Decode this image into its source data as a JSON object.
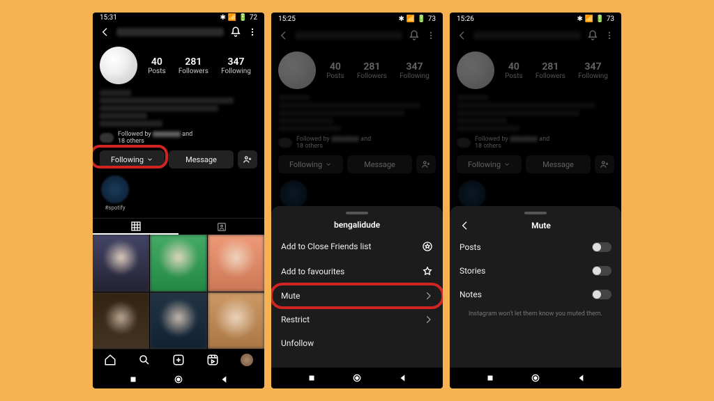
{
  "phones": [
    {
      "time": "15:31",
      "battery": "72"
    },
    {
      "time": "15:25",
      "battery": "73"
    },
    {
      "time": "15:26",
      "battery": "73"
    }
  ],
  "stats": {
    "posts": {
      "n": "40",
      "l": "Posts"
    },
    "followers": {
      "n": "281",
      "l": "Followers"
    },
    "following": {
      "n": "347",
      "l": "Following"
    }
  },
  "followed_by": "Followed by",
  "followed_others": "18 others",
  "buttons": {
    "following": "Following",
    "message": "Message"
  },
  "story_label": "#spotify",
  "sheet1": {
    "title": "bengalidude",
    "close_friends": "Add to Close Friends list",
    "favourites": "Add to favourites",
    "mute": "Mute",
    "restrict": "Restrict",
    "unfollow": "Unfollow"
  },
  "sheet2": {
    "title": "Mute",
    "posts": "Posts",
    "stories": "Stories",
    "notes": "Notes",
    "note": "Instagram won't let them know you muted them."
  }
}
